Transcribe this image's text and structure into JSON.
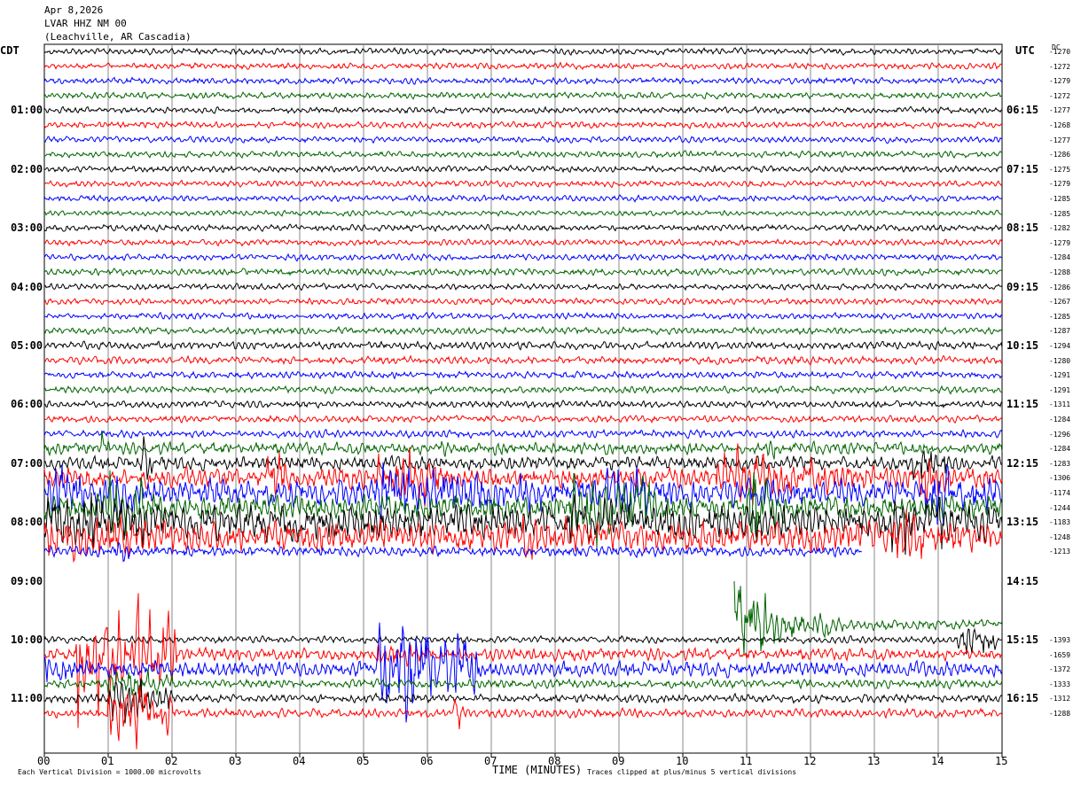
{
  "header": {
    "date": "Apr 8,2026",
    "station": "LVAR HHZ NM 00",
    "location": "(Leachville, AR Cascadia)"
  },
  "left_tz": "CDT",
  "right_tz": "UTC",
  "dc_header": "DC",
  "footer": {
    "scale": "Each Vertical Division = 1000.00 microvolts",
    "xlabel": "TIME (MINUTES)",
    "clip": "Traces clipped at plus/minus 5 vertical divisions"
  },
  "chart_data": {
    "type": "line",
    "xlabel": "TIME (MINUTES)",
    "xlim": [
      0,
      15
    ],
    "x_ticks": [
      "00",
      "01",
      "02",
      "03",
      "04",
      "05",
      "06",
      "07",
      "08",
      "09",
      "10",
      "11",
      "12",
      "13",
      "14",
      "15"
    ],
    "left_labels": [
      "01:00",
      "02:00",
      "03:00",
      "04:00",
      "05:00",
      "06:00",
      "07:00",
      "08:00",
      "09:00",
      "10:00",
      "11:00"
    ],
    "right_labels": [
      "06:15",
      "07:15",
      "08:15",
      "09:15",
      "10:15",
      "11:15",
      "12:15",
      "13:15",
      "14:15",
      "15:15",
      "16:15"
    ],
    "trace_colors": [
      "#000000",
      "#ff0000",
      "#0000ff",
      "#006400"
    ],
    "minutes_per_row": 15,
    "clip_divisions": 5,
    "rows": [
      {
        "dc": "-1270",
        "amp": 0.18
      },
      {
        "dc": "-1272",
        "amp": 0.18
      },
      {
        "dc": "-1279",
        "amp": 0.18
      },
      {
        "dc": "-1272",
        "amp": 0.18
      },
      {
        "dc": "-1277",
        "amp": 0.18
      },
      {
        "dc": "-1268",
        "amp": 0.18
      },
      {
        "dc": "-1277",
        "amp": 0.18
      },
      {
        "dc": "-1286",
        "amp": 0.18
      },
      {
        "dc": "-1275",
        "amp": 0.18
      },
      {
        "dc": "-1279",
        "amp": 0.18
      },
      {
        "dc": "-1285",
        "amp": 0.18
      },
      {
        "dc": "-1285",
        "amp": 0.15
      },
      {
        "dc": "-1282",
        "amp": 0.18
      },
      {
        "dc": "-1279",
        "amp": 0.18
      },
      {
        "dc": "-1284",
        "amp": 0.18
      },
      {
        "dc": "-1288",
        "amp": 0.2
      },
      {
        "dc": "-1286",
        "amp": 0.18
      },
      {
        "dc": "-1267",
        "amp": 0.18
      },
      {
        "dc": "-1285",
        "amp": 0.18
      },
      {
        "dc": "-1287",
        "amp": 0.2
      },
      {
        "dc": "-1294",
        "amp": 0.22
      },
      {
        "dc": "-1280",
        "amp": 0.22
      },
      {
        "dc": "-1291",
        "amp": 0.2
      },
      {
        "dc": "-1291",
        "amp": 0.2
      },
      {
        "dc": "-1311",
        "amp": 0.2
      },
      {
        "dc": "-1284",
        "amp": 0.2
      },
      {
        "dc": "-1296",
        "amp": 0.22
      },
      {
        "dc": "-1284",
        "amp": 0.35,
        "bursts": [
          [
            0.9,
            1.0,
            1.2
          ],
          [
            6.2,
            6.4,
            0.8
          ],
          [
            11.3,
            11.5,
            0.8
          ]
        ]
      },
      {
        "dc": "-1283",
        "amp": 0.4,
        "bursts": [
          [
            1.5,
            1.7,
            1.5
          ],
          [
            13.6,
            14.2,
            1.2
          ]
        ]
      },
      {
        "dc": "-1306",
        "amp": 0.6,
        "bursts": [
          [
            3.5,
            4.0,
            1.3
          ],
          [
            5.2,
            6.3,
            1.6
          ],
          [
            10.5,
            13.0,
            1.3
          ],
          [
            13.7,
            14.2,
            1.8
          ]
        ]
      },
      {
        "dc": "-1174",
        "amp": 0.8,
        "bursts": [
          [
            0,
            1.8,
            1.5
          ],
          [
            5.2,
            7.8,
            1.8
          ],
          [
            8.8,
            9.6,
            1.6
          ],
          [
            13.8,
            15,
            1.6
          ]
        ]
      },
      {
        "dc": "-1244",
        "amp": 0.7,
        "bursts": [
          [
            1.0,
            2.0,
            1.8
          ],
          [
            8.2,
            9.6,
            2.5
          ],
          [
            11.0,
            11.6,
            2.6
          ]
        ]
      },
      {
        "dc": "-1183",
        "amp": 1.0,
        "bursts": [
          [
            0,
            2.2,
            1.6
          ],
          [
            8.2,
            9.2,
            1.5
          ],
          [
            13.2,
            14.4,
            2.0
          ]
        ]
      },
      {
        "dc": "-1248",
        "amp": 0.9,
        "bursts": [
          [
            0,
            2.4,
            1.3
          ],
          [
            7.5,
            8.5,
            1.2
          ],
          [
            13.3,
            14.2,
            1.5
          ]
        ]
      },
      {
        "dc": "-1213",
        "amp": 0.3,
        "end": 12.8,
        "bursts": [
          [
            1.1,
            1.4,
            1.0
          ],
          [
            13.5,
            14.2,
            2.5
          ]
        ]
      },
      {
        "dc": "",
        "amp": 0,
        "end": 0
      },
      {
        "dc": "",
        "amp": 0,
        "end": 0
      },
      {
        "dc": "",
        "amp": 0,
        "end": 0
      },
      {
        "dc": "",
        "amp": 0,
        "end": 0
      },
      {
        "dc": "",
        "amp": 0.3,
        "start": 10.8,
        "bursts": [
          [
            10.8,
            11.5,
            2.6
          ],
          [
            11.5,
            12.5,
            1.0
          ]
        ]
      },
      {
        "dc": "-1393",
        "amp": 0.2,
        "start": 0,
        "bursts": [
          [
            14.3,
            15,
            1.0
          ],
          [
            9.0,
            9.1,
            0.6
          ]
        ]
      },
      {
        "dc": "-1659",
        "amp": 0.35,
        "bursts": [
          [
            0.5,
            2.1,
            3.2
          ],
          [
            5.2,
            6.0,
            0.8
          ]
        ]
      },
      {
        "dc": "-1372",
        "amp": 0.45,
        "bursts": [
          [
            0,
            0.6,
            1.0
          ],
          [
            5.2,
            6.8,
            3.0
          ]
        ]
      },
      {
        "dc": "-1333",
        "amp": 0.25,
        "bursts": [
          [
            1.0,
            2.0,
            1.0
          ]
        ]
      },
      {
        "dc": "-1312",
        "amp": 0.25,
        "bursts": [
          [
            1.0,
            2.0,
            1.2
          ]
        ]
      },
      {
        "dc": "-1288",
        "amp": 0.25,
        "bursts": [
          [
            1.0,
            2.0,
            1.8
          ],
          [
            6.4,
            6.6,
            1.2
          ]
        ]
      }
    ]
  }
}
